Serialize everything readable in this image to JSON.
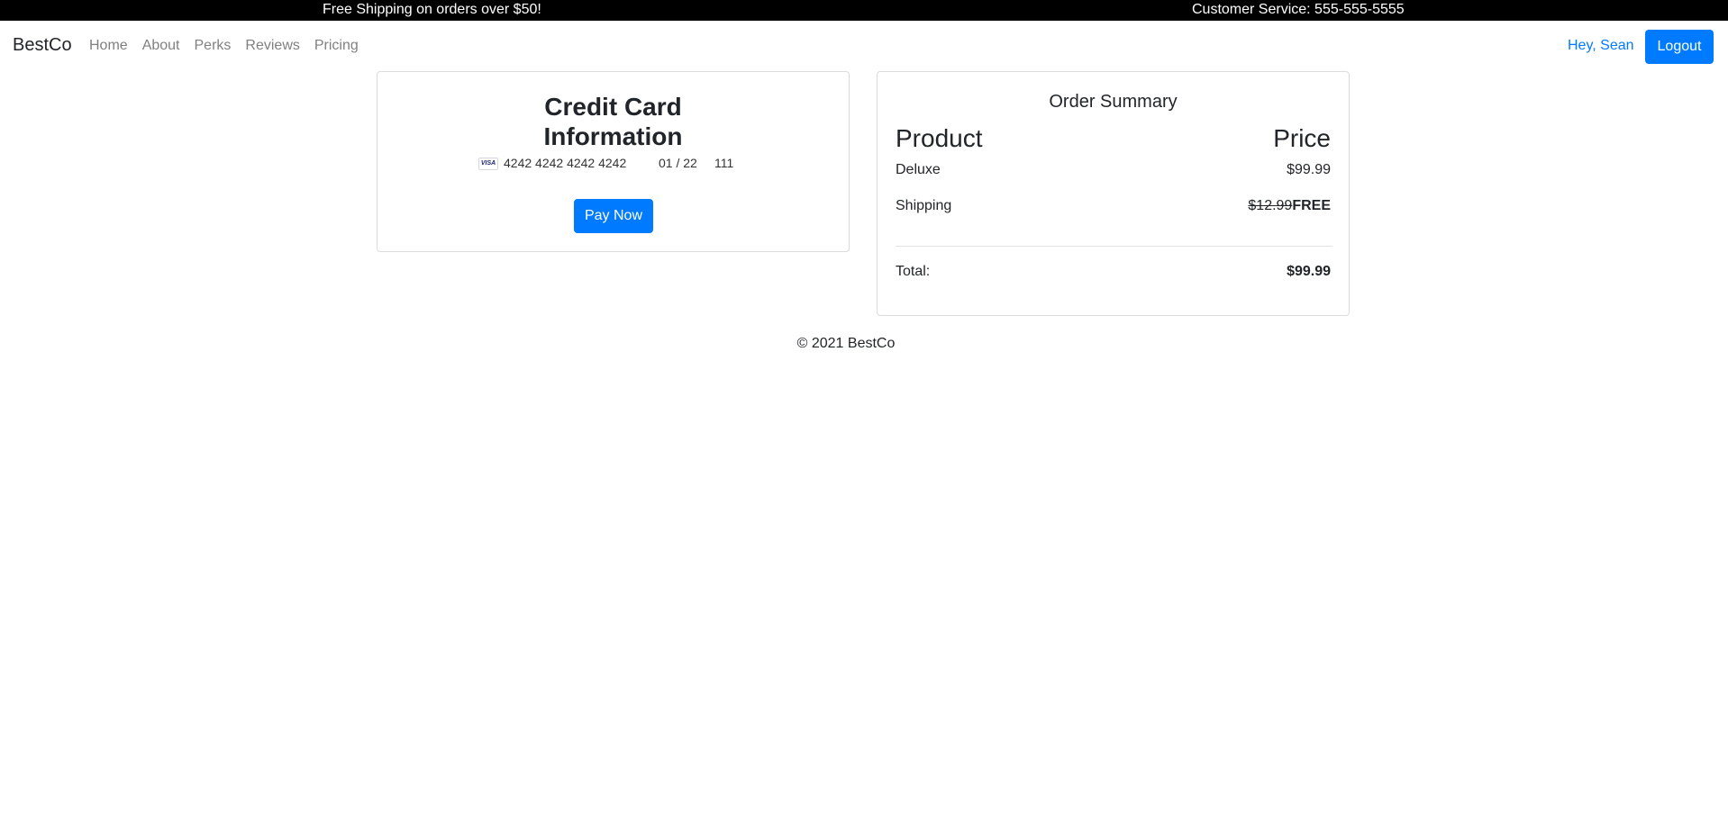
{
  "topbar": {
    "promo": "Free Shipping on orders over $50!",
    "service": "Customer Service: 555-555-5555"
  },
  "navbar": {
    "brand": "BestCo",
    "links": [
      "Home",
      "About",
      "Perks",
      "Reviews",
      "Pricing"
    ],
    "greeting": "Hey, Sean",
    "logout": "Logout"
  },
  "credit_card": {
    "title_line1": "Credit Card",
    "title_line2": "Information",
    "card_brand": "VISA",
    "card_number": "4242 4242 4242 4242",
    "expiry": "01 / 22",
    "cvc": "111",
    "pay_button": "Pay Now"
  },
  "order_summary": {
    "title": "Order Summary",
    "col_product": "Product",
    "col_price": "Price",
    "items": [
      {
        "name": "Deluxe",
        "price": "$99.99"
      }
    ],
    "shipping_label": "Shipping",
    "shipping_original": "$12.99",
    "shipping_value": "FREE",
    "total_label": "Total:",
    "total_value": "$99.99"
  },
  "footer": {
    "copyright": "© 2021 BestCo"
  },
  "colors": {
    "primary": "#007bff",
    "topbar_bg": "#000000",
    "nav_link": "#808080"
  }
}
